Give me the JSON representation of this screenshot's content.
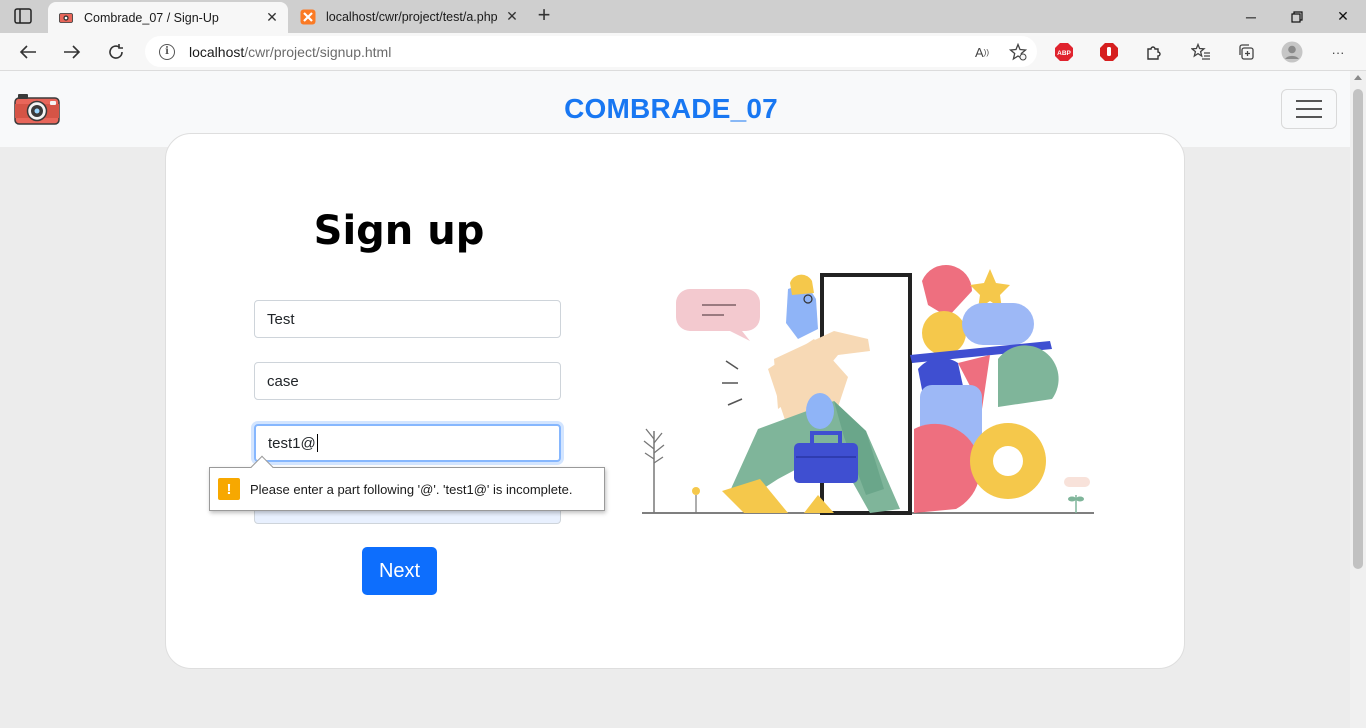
{
  "browser": {
    "tabs": [
      {
        "title": "Combrade_07 / Sign-Up",
        "active": true
      },
      {
        "title": "localhost/cwr/project/test/a.php",
        "active": false
      }
    ],
    "address": {
      "host": "localhost",
      "path": "/cwr/project/signup.html"
    },
    "extensions": [
      "abp-icon",
      "stop-icon",
      "puzzle-icon"
    ]
  },
  "site": {
    "brand": "COMBRADE_07",
    "accent": "#1877f2"
  },
  "form": {
    "heading": "Sign up",
    "first_name": "Test",
    "last_name": "case",
    "email": "test1@",
    "next_label": "Next",
    "validation_message": "Please enter a part following '@'. 'test1@' is incomplete."
  }
}
